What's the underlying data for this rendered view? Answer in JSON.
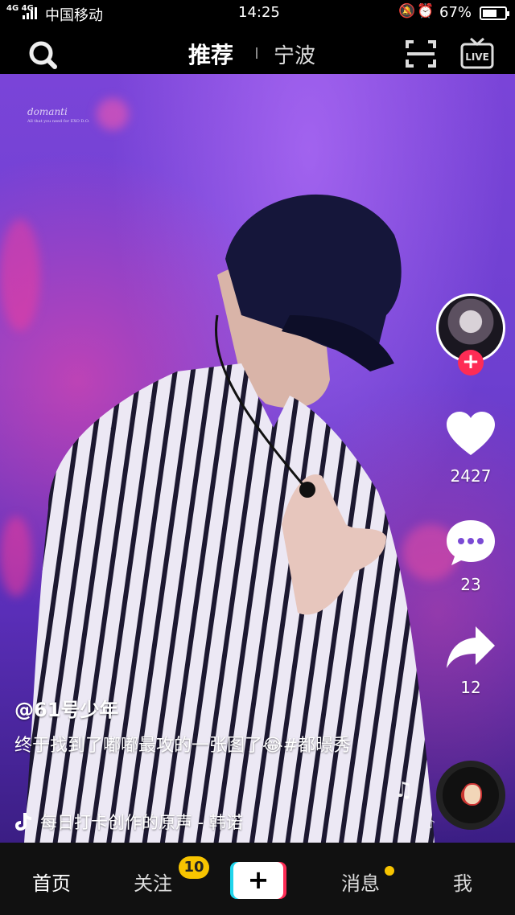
{
  "status_bar": {
    "network": "4G 4G",
    "carrier": "中国移动",
    "time": "14:25",
    "battery_percent": "67%",
    "battery_level": 0.67
  },
  "top_nav": {
    "tab_recommend": "推荐",
    "tab_city": "宁波",
    "live_label": "LIVE"
  },
  "video": {
    "watermark": "domanti",
    "watermark_sub": "All that you need for EXO D.O."
  },
  "actions": {
    "follow": "+",
    "likes": "2427",
    "comments": "23",
    "shares": "12"
  },
  "post": {
    "author": "@61号少年",
    "description": "终于找到了嘟嘟最攻的一张图了😂#都暻秀",
    "music": "每日打卡创作的原声 - 韩诺"
  },
  "bottom_nav": {
    "home": "首页",
    "following": "关注",
    "following_badge": "10",
    "create": "+",
    "messages": "消息",
    "me": "我"
  },
  "colors": {
    "accent_red": "#fe2c55",
    "accent_cyan": "#20d5ec",
    "badge_yellow": "#f7c400"
  }
}
